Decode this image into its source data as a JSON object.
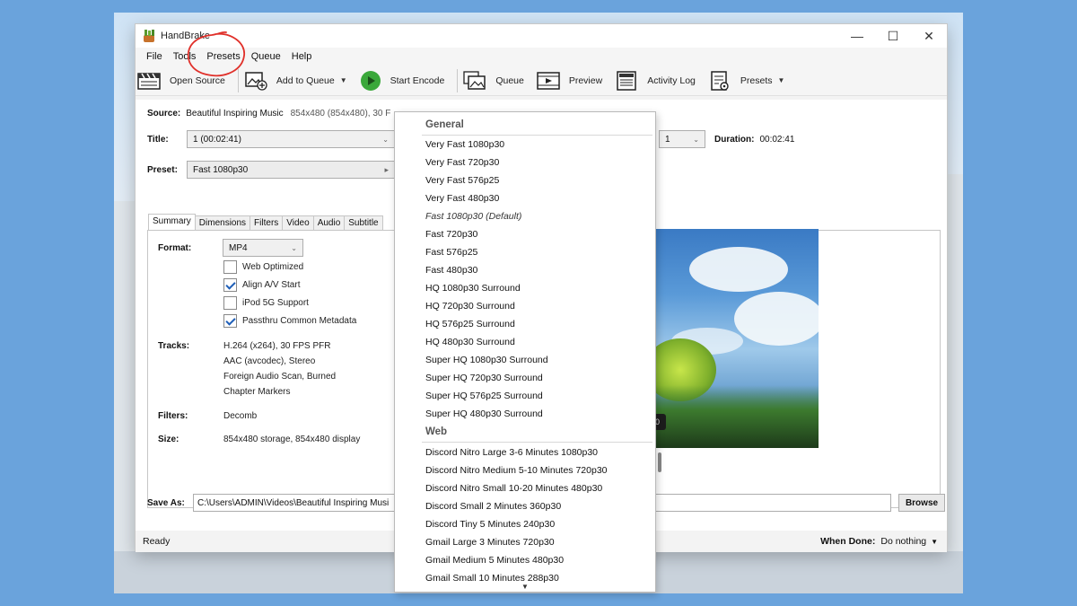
{
  "window": {
    "title": "HandBrake",
    "controls": {
      "minimize": "—",
      "maximize": "☐",
      "close": "✕"
    }
  },
  "menu": [
    "File",
    "Tools",
    "Presets",
    "Queue",
    "Help"
  ],
  "toolbar": {
    "open_source": "Open Source",
    "add_to_queue": "Add to Queue",
    "start_encode": "Start Encode",
    "queue": "Queue",
    "preview": "Preview",
    "activity_log": "Activity Log",
    "presets": "Presets"
  },
  "source": {
    "label": "Source:",
    "name": "Beautiful Inspiring Music",
    "info": "854x480 (854x480), 30 F"
  },
  "title_row": {
    "label": "Title:",
    "value": "1  (00:02:41)",
    "chapter_end": "1",
    "duration_label": "Duration:",
    "duration": "00:02:41"
  },
  "preset_row": {
    "label": "Preset:",
    "value": "Fast 1080p30"
  },
  "tabs": [
    "Summary",
    "Dimensions",
    "Filters",
    "Video",
    "Audio",
    "Subtitle"
  ],
  "summary": {
    "format_label": "Format:",
    "format_value": "MP4",
    "options": [
      {
        "label": "Web Optimized",
        "checked": false
      },
      {
        "label": "Align A/V Start",
        "checked": true
      },
      {
        "label": "iPod 5G Support",
        "checked": false
      },
      {
        "label": "Passthru Common Metadata",
        "checked": true
      }
    ],
    "tracks_label": "Tracks:",
    "tracks": [
      "H.264 (x264), 30 FPS PFR",
      "AAC (avcodec), Stereo",
      "Foreign Audio Scan, Burned",
      "Chapter Markers"
    ],
    "filters_label": "Filters:",
    "filters_value": "Decomb",
    "size_label": "Size:",
    "size_value": "854x480 storage, 854x480 display"
  },
  "preview_overlay_text": "0",
  "save_as": {
    "label": "Save As:",
    "path": "C:\\Users\\ADMIN\\Videos\\Beautiful Inspiring Musi",
    "browse": "Browse"
  },
  "status": {
    "text": "Ready",
    "when_done_label": "When Done:",
    "when_done_value": "Do nothing"
  },
  "presets_dropdown": {
    "groups": [
      {
        "name": "General",
        "items": [
          "Very Fast 1080p30",
          "Very Fast 720p30",
          "Very Fast 576p25",
          "Very Fast 480p30",
          "Fast 1080p30 (Default)",
          "Fast 720p30",
          "Fast 576p25",
          "Fast 480p30",
          "HQ 1080p30 Surround",
          "HQ 720p30 Surround",
          "HQ 576p25 Surround",
          "HQ 480p30 Surround",
          "Super HQ 1080p30 Surround",
          "Super HQ 720p30 Surround",
          "Super HQ 576p25 Surround",
          "Super HQ 480p30 Surround"
        ]
      },
      {
        "name": "Web",
        "items": [
          "Discord Nitro Large 3-6 Minutes 1080p30",
          "Discord Nitro Medium 5-10 Minutes 720p30",
          "Discord Nitro Small 10-20 Minutes 480p30",
          "Discord Small 2 Minutes 360p30",
          "Discord Tiny 5 Minutes 240p30",
          "Gmail Large 3 Minutes 720p30",
          "Gmail Medium 5 Minutes 480p30",
          "Gmail Small 10 Minutes 288p30"
        ]
      }
    ],
    "default_item": "Fast 1080p30 (Default)"
  },
  "colors": {
    "background": "#6aa3dc",
    "annotation": "#e0302a",
    "start_encode_green": "#3aa83a",
    "checkbox_blue": "#1f5fb8"
  }
}
